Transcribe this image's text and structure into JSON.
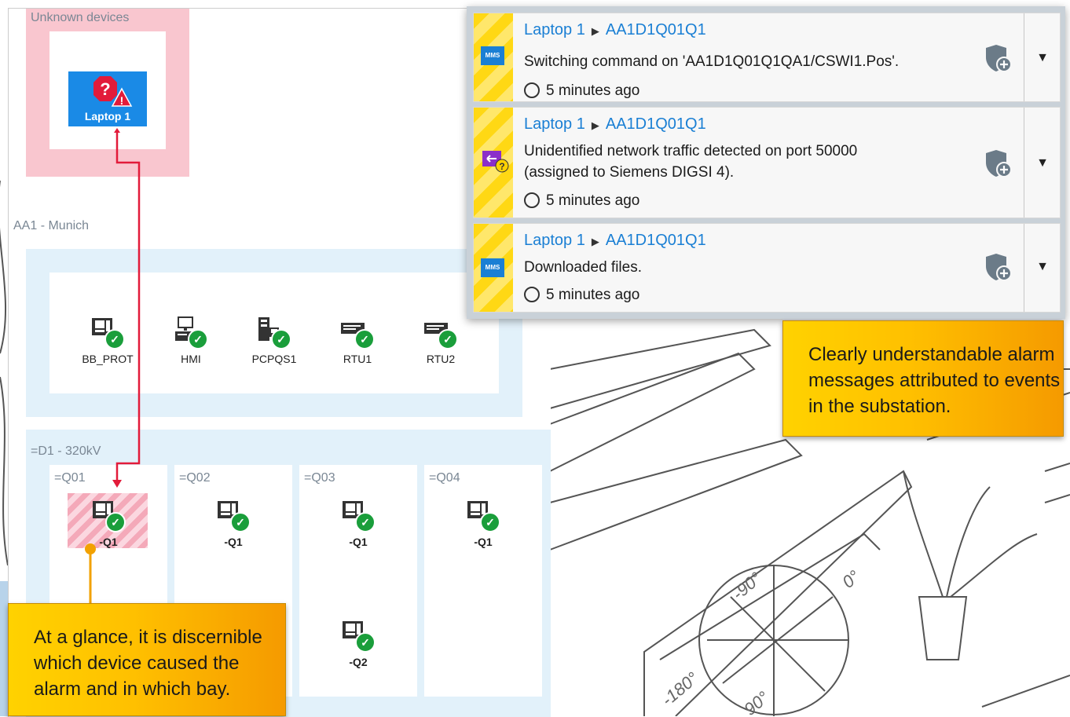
{
  "zones": {
    "unknown_label": "Unknown devices",
    "station_label": "AA1 - Munich",
    "bay_zone_label": "=D1 - 320kV"
  },
  "unknown_device": {
    "label": "Laptop 1"
  },
  "station_devices": [
    {
      "label": "BB_PROT",
      "icon": "protection-relay-icon"
    },
    {
      "label": "HMI",
      "icon": "workstation-icon"
    },
    {
      "label": "PCPQS1",
      "icon": "power-quality-icon"
    },
    {
      "label": "RTU1",
      "icon": "rtu-icon"
    },
    {
      "label": "RTU2",
      "icon": "rtu-icon"
    }
  ],
  "bays": [
    {
      "label": "=Q01",
      "devices": [
        "-Q1"
      ]
    },
    {
      "label": "=Q02",
      "devices": [
        "-Q1"
      ]
    },
    {
      "label": "=Q03",
      "devices": [
        "-Q1",
        "-Q2"
      ]
    },
    {
      "label": "=Q04",
      "devices": [
        "-Q1"
      ]
    }
  ],
  "alarms": [
    {
      "source": "Laptop 1",
      "target": "AA1D1Q01Q1",
      "type_icon": "mms-icon",
      "type_label": "MMS",
      "message": "Switching command on 'AA1D1Q01Q1QA1/CSWI1.Pos'.",
      "message_line2": "",
      "time": "5 minutes ago"
    },
    {
      "source": "Laptop 1",
      "target": "AA1D1Q01Q1",
      "type_icon": "unknown-traffic-icon",
      "type_label": "",
      "message": "Unidentified network traffic detected on port 50000",
      "message_line2": "(assigned to Siemens DIGSI 4).",
      "time": "5 minutes ago"
    },
    {
      "source": "Laptop 1",
      "target": "AA1D1Q01Q1",
      "type_icon": "mms-icon",
      "type_label": "MMS",
      "message": "Downloaded files.",
      "message_line2": "",
      "time": "5 minutes ago"
    }
  ],
  "callouts": {
    "right": "Clearly understandable alarm messages attributed to events in the substation.",
    "left": "At a glance, it is discernible which device caused the alarm and in which bay."
  },
  "colors": {
    "alarm_red": "#e21b3a",
    "ok_green": "#1a9e3b",
    "device_blue": "#1a8ae6",
    "callout_yellow": "#ffc000",
    "connector_orange": "#f2a100"
  }
}
